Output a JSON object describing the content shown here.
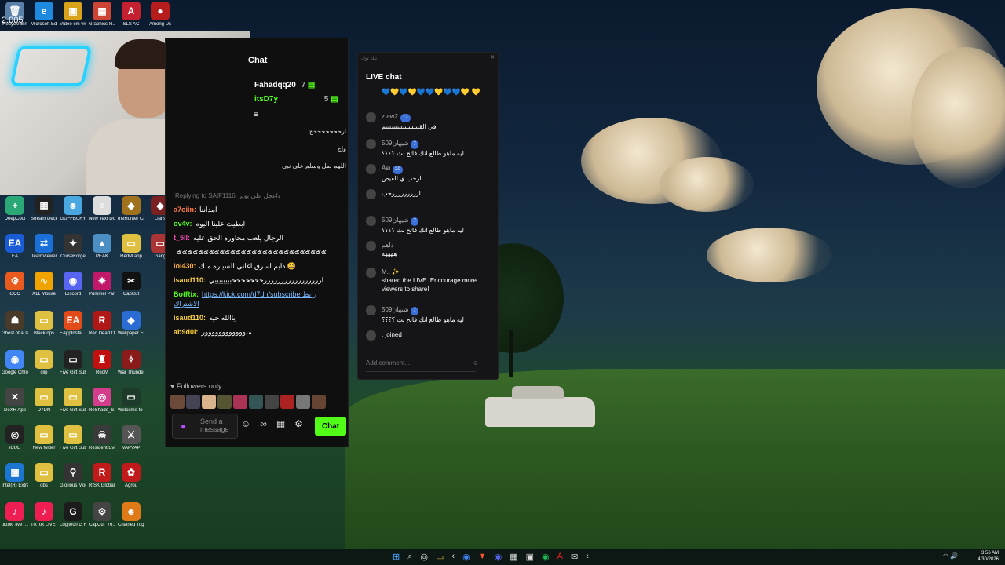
{
  "webcam": {
    "timer": "2.005"
  },
  "desktop_icons": [
    {
      "label": "Recycle Bin",
      "glyph": "🗑",
      "color": "#5a7fa8"
    },
    {
      "label": "Microsoft Edge",
      "glyph": "e",
      "color": "#1e8adf"
    },
    {
      "label": "Vídeo em vivo",
      "glyph": "▣",
      "color": "#d9a21b"
    },
    {
      "label": "Graphics-R...",
      "glyph": "▦",
      "color": "#c43"
    },
    {
      "label": "SLS AC",
      "glyph": "A",
      "color": "#c4202f"
    },
    {
      "label": "Among Us",
      "glyph": "●",
      "color": "#b71c1c"
    },
    {
      "label": "DeepCool",
      "glyph": "+",
      "color": "#2aa876"
    },
    {
      "label": "Stream Deck",
      "glyph": "▦",
      "color": "#222"
    },
    {
      "label": "GUFFBURY",
      "glyph": "☻",
      "color": "#4aa7e0"
    },
    {
      "label": "New Text Document",
      "glyph": "≡",
      "color": "#ddd"
    },
    {
      "label": "theHunter Call of t...",
      "glyph": "◆",
      "color": "#a0721e"
    },
    {
      "label": "Liar's",
      "glyph": "◆",
      "color": "#7a2020"
    },
    {
      "label": "EA",
      "glyph": "EA",
      "color": "#1a5cd6"
    },
    {
      "label": "TeamViewer",
      "glyph": "⇄",
      "color": "#1b6fd8"
    },
    {
      "label": "CurseForge",
      "glyph": "✦",
      "color": "#333"
    },
    {
      "label": "PEAK",
      "glyph": "▲",
      "color": "#4b8fc4"
    },
    {
      "label": "RedM.app",
      "glyph": "▭",
      "color": "#e0c040"
    },
    {
      "label": "Gang",
      "glyph": "▭",
      "color": "#a33"
    },
    {
      "label": "GCC",
      "glyph": "⚙",
      "color": "#e85a1e"
    },
    {
      "label": "X11 Mouse",
      "glyph": "∿",
      "color": "#f1a400"
    },
    {
      "label": "Discord",
      "glyph": "◉",
      "color": "#5865f2"
    },
    {
      "label": "Pummel Party",
      "glyph": "✸",
      "color": "#c2186a"
    },
    {
      "label": "CapCut",
      "glyph": "✂",
      "color": "#111"
    },
    {
      "label": "Ghost of a Tale",
      "glyph": "☗",
      "color": "#4a3a2a"
    },
    {
      "label": "Black ops",
      "glyph": "▭",
      "color": "#e0c040"
    },
    {
      "label": "EAppInstal...",
      "glyph": "EA",
      "color": "#e24a1a"
    },
    {
      "label": "Red Dead Online",
      "glyph": "R",
      "color": "#b01818"
    },
    {
      "label": "Wallpaper Engine",
      "glyph": "◈",
      "color": "#2b6cd4"
    },
    {
      "label": "Google Chrome",
      "glyph": "◉",
      "color": "#4285f4"
    },
    {
      "label": "clip",
      "glyph": "▭",
      "color": "#e0c040"
    },
    {
      "label": "Five Gift Subs (1)",
      "glyph": "▭",
      "color": "#222"
    },
    {
      "label": "RedM",
      "glyph": "♜",
      "color": "#c01010"
    },
    {
      "label": "War Thunder",
      "glyph": "✧",
      "color": "#8b1a1a"
    },
    {
      "label": "DeXR App",
      "glyph": "✕",
      "color": "#444"
    },
    {
      "label": "D7DN",
      "glyph": "▭",
      "color": "#e0c040"
    },
    {
      "label": "Five Gift Subs",
      "glyph": "▭",
      "color": "#e0c040"
    },
    {
      "label": "ReShade_S...",
      "glyph": "◎",
      "color": "#d43c8c"
    },
    {
      "label": "Welcome to Kowloon",
      "glyph": "▭",
      "color": "#1d3a2a"
    },
    {
      "label": "iCUE",
      "glyph": "◎",
      "color": "#222"
    },
    {
      "label": "New folder",
      "glyph": "▭",
      "color": "#e0c040"
    },
    {
      "label": "Five Gift Subs-2025",
      "glyph": "▭",
      "color": "#e0c040"
    },
    {
      "label": "Resident Evil Requiem",
      "glyph": "☠",
      "color": "#3a3a3a"
    },
    {
      "label": "VAPVAP",
      "glyph": "⚔",
      "color": "#555"
    },
    {
      "label": "Intel(R) Extre...",
      "glyph": "▦",
      "color": "#1b76d1"
    },
    {
      "label": "obs",
      "glyph": "▭",
      "color": "#e0c040"
    },
    {
      "label": "Glorious Model ...",
      "glyph": "⚲",
      "color": "#333"
    },
    {
      "label": "RISK Global Domination",
      "glyph": "R",
      "color": "#c01a1a"
    },
    {
      "label": "Agrou",
      "glyph": "✿",
      "color": "#c01a1a"
    },
    {
      "label": "tiktok_live_...",
      "glyph": "♪",
      "color": "#ee1d52"
    },
    {
      "label": "TikTok LIVE Studio",
      "glyph": "♪",
      "color": "#ee1d52"
    },
    {
      "label": "Logitech G HUB",
      "glyph": "G",
      "color": "#1b1b1b"
    },
    {
      "label": "CapCut_76...",
      "glyph": "⚙",
      "color": "#444"
    },
    {
      "label": "Chained Together",
      "glyph": "☻",
      "color": "#e07a18"
    }
  ],
  "kick_chat": {
    "title": "Chat",
    "leaders": [
      {
        "name": "Fahadqq20",
        "count": "7"
      },
      {
        "name": "itsD7y",
        "count": "5"
      }
    ],
    "pinned_lines": [
      "ارحححححححح",
      "واج",
      "اللهم صل وسلم على نبي"
    ],
    "reply_hint": "Replying to SAIF1116: واعجل على بويز",
    "messages": [
      {
        "user": "a7oiin:",
        "text": "امداننا",
        "color": "#ff7a45"
      },
      {
        "user": "ov4v:",
        "text": "ابطيت علينا اليوم",
        "color": "#53fc18"
      },
      {
        "user": "t_5ll:",
        "text": "الرجال يلعب محاوره الحق عليه",
        "color": "#ff4db8"
      },
      {
        "user": "",
        "text": "๕๕๕๕๕๕๕๕๕๕๕๕๕๕๕๕๕๕๕๕๕๕๕๕๕๕๕๕",
        "color": "#fff"
      },
      {
        "user": "lol430:",
        "text": "دايم اسرق اغاني السياره منك 😄",
        "color": "#ffb03b"
      },
      {
        "user": "isaud110:",
        "text": "ارررررررررررررررررحححححححبيييييييي",
        "color": "#ffd23f"
      },
      {
        "user": "BotRix:",
        "text": "https://kick.com/d7dn/subscribe رابط الاشتراك",
        "color": "#53fc18"
      },
      {
        "user": "isaud110:",
        "text": "ياالله حيه",
        "color": "#ffd23f"
      },
      {
        "user": "ab9d0l:",
        "text": "منوووووووووووور",
        "color": "#ffd23f"
      }
    ],
    "followers_label": "Followers only",
    "input_placeholder": "Send a message",
    "chat_button": "Chat"
  },
  "tiktok_chat": {
    "window_title": "تيك توك",
    "title": "LIVE chat",
    "hearts": "💙💛💙💛💙💙💛💙💙💛 💛",
    "messages": [
      {
        "name": "z.aw2",
        "badge": "17",
        "text": "في القسسسسسسم"
      },
      {
        "name": "شيهان509",
        "badge": "7",
        "text": "ليه ماهو طالع انك فاتح بث ؟؟؟؟"
      },
      {
        "name": "Âsi",
        "badge": "20",
        "text": "ارحب ي القيص"
      },
      {
        "name": "",
        "badge": "",
        "text": "ارررررررررحب"
      },
      {
        "name": "شيهان509",
        "badge": "7",
        "text": "ليه ماهو طالع انك فاتح بث ؟؟؟؟"
      },
      {
        "name": "داهم",
        "badge": "",
        "text": "ههههه"
      },
      {
        "name": "M.. ✨",
        "badge": "",
        "text": "shared the LIVE. Encourage more viewers to share!"
      },
      {
        "name": "شيهان509",
        "badge": "7",
        "text": "ليه ماهو طالع انك فاتح بث ؟؟؟؟"
      },
      {
        "name": "",
        "badge": "",
        "text": ". joined"
      }
    ],
    "input_placeholder": "Add comment..."
  },
  "taskbar": {
    "time": "3:56 AM",
    "date": "4/30/2026",
    "icons": [
      "windows-logo",
      "search",
      "copilot",
      "file-explorer",
      "arrow",
      "chrome",
      "brave",
      "discord",
      "game",
      "taskview",
      "spotify",
      "adobe",
      "mail",
      "arrow2"
    ]
  }
}
